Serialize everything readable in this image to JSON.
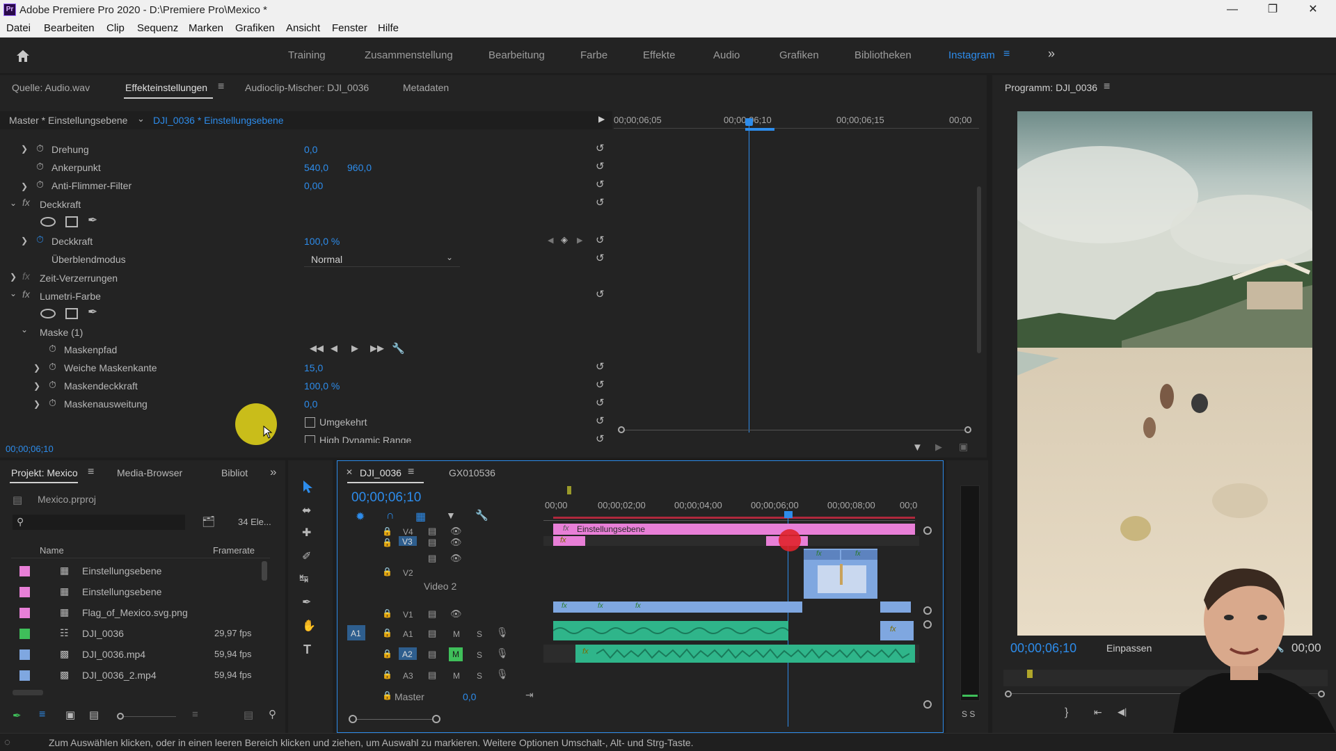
{
  "window": {
    "title": "Adobe Premiere Pro 2020 - D:\\Premiere Pro\\Mexico *",
    "logo": "Pr"
  },
  "menu": [
    "Datei",
    "Bearbeiten",
    "Clip",
    "Sequenz",
    "Marken",
    "Grafiken",
    "Ansicht",
    "Fenster",
    "Hilfe"
  ],
  "workspaces": [
    "Training",
    "Zusammenstellung",
    "Bearbeitung",
    "Farbe",
    "Effekte",
    "Audio",
    "Grafiken",
    "Bibliotheken",
    "Instagram"
  ],
  "effect_panel": {
    "tabs": [
      "Quelle: Audio.wav",
      "Effekteinstellungen",
      "Audioclip-Mischer: DJI_0036",
      "Metadaten"
    ],
    "master_label": "Master * Einstellungsebene",
    "clip_label": "DJI_0036 * Einstellungsebene",
    "ruler": [
      "00;00;06;05",
      "00;00;06;10",
      "00;00;06;15",
      "00;00"
    ],
    "rows": {
      "drehung": {
        "label": "Drehung",
        "value": "0,0"
      },
      "ankerpunkt": {
        "label": "Ankerpunkt",
        "v1": "540,0",
        "v2": "960,0"
      },
      "antiflimmer": {
        "label": "Anti-Flimmer-Filter",
        "value": "0,00"
      },
      "deckkraft_group": "Deckkraft",
      "deckkraft": {
        "label": "Deckkraft",
        "value": "100,0 %"
      },
      "ueberblend": {
        "label": "Überblendmodus",
        "value": "Normal"
      },
      "zeit": "Zeit-Verzerrungen",
      "lumetri": "Lumetri-Farbe",
      "maske": "Maske (1)",
      "maskenpfad": "Maskenpfad",
      "weiche": {
        "label": "Weiche Maskenkante",
        "value": "15,0"
      },
      "deckung": {
        "label": "Maskendeckkraft",
        "value": "100,0 %"
      },
      "ausweitung": {
        "label": "Maskenausweitung",
        "value": "0,0"
      },
      "umgekehrt": "Umgekehrt",
      "hdr": "High Dynamic Range"
    },
    "timecode": "00;00;06;10"
  },
  "program": {
    "title": "Programm: DJI_0036",
    "timecode": "00;00;06;10",
    "fit": "Einpassen",
    "end": "00;00"
  },
  "project": {
    "tabs": [
      "Projekt: Mexico",
      "Media-Browser",
      "Bibliot"
    ],
    "file": "Mexico.prproj",
    "count": "34 Ele...",
    "columns": [
      "Name",
      "Framerate"
    ],
    "items": [
      {
        "name": "Einstellungsebene",
        "fps": "",
        "color": "#e87fd7"
      },
      {
        "name": "Einstellungsebene",
        "fps": "",
        "color": "#e87fd7"
      },
      {
        "name": "Flag_of_Mexico.svg.png",
        "fps": "",
        "color": "#e87fd7"
      },
      {
        "name": "DJI_0036",
        "fps": "29,97 fps",
        "color": "#3fbf5a"
      },
      {
        "name": "DJI_0036.mp4",
        "fps": "59,94 fps",
        "color": "#7fa7e0"
      },
      {
        "name": "DJI_0036_2.mp4",
        "fps": "59,94 fps",
        "color": "#7fa7e0"
      }
    ]
  },
  "timeline": {
    "tabs": [
      "DJI_0036",
      "GX010536"
    ],
    "timecode": "00;00;06;10",
    "ruler": [
      "00;00",
      "00;00;02;00",
      "00;00;04;00",
      "00;00;06;00",
      "00;00;08;00",
      "00;0"
    ],
    "tracks": {
      "v4": "V4",
      "v3": "V3",
      "v2": "V2",
      "v2name": "Video 2",
      "v1": "V1",
      "a1": "A1",
      "a1src": "A1",
      "a2": "A2",
      "a3": "A3",
      "m": "M",
      "s": "S",
      "master": "Master",
      "master_val": "0,0"
    },
    "adjustment_clip": "Einstellungsebene",
    "fx": "fx"
  },
  "status": "Zum Auswählen klicken, oder in einen leeren Bereich klicken und ziehen, um Auswahl zu markieren. Weitere Optionen Umschalt-, Alt- und Strg-Taste.",
  "meter_labels": "S S",
  "colors": {
    "accent": "#2d8ceb",
    "pink": "#e87fd7",
    "green": "#3fbf5a",
    "audio": "#2fb58a",
    "clipblue": "#7fa7e0"
  }
}
